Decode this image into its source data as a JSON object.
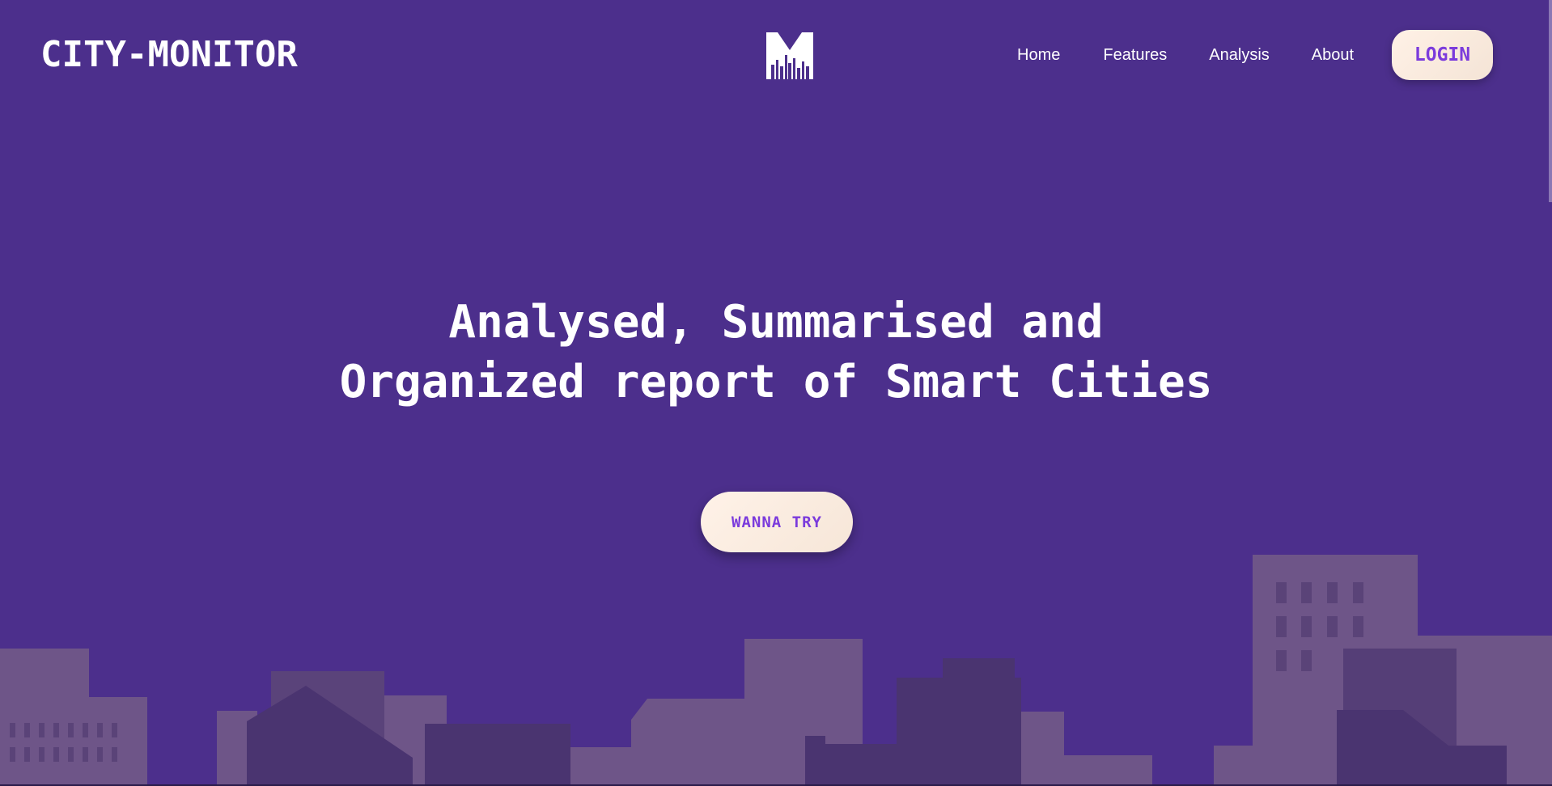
{
  "brand": {
    "name": "CITY-MONITOR"
  },
  "logo": {
    "letter": "M",
    "icon": "city-skyline-icon"
  },
  "nav": {
    "items": [
      {
        "label": "Home"
      },
      {
        "label": "Features"
      },
      {
        "label": "Analysis"
      },
      {
        "label": "About"
      }
    ]
  },
  "login": {
    "label": "LOGIN"
  },
  "hero": {
    "line1": "Analysed, Summarised and",
    "line2": "Organized report of Smart Cities",
    "cta_label": "WANNA TRY"
  },
  "colors": {
    "background": "#4c2f8c",
    "accent_text": "#7b3bdc",
    "button_bg": "#fff1e6",
    "building_light": "#6e5588",
    "building_dark": "#4a3470"
  }
}
